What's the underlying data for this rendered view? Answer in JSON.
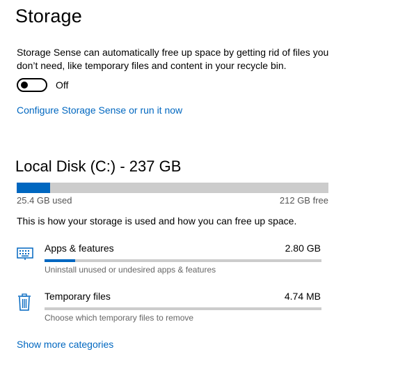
{
  "page_title": "Storage",
  "description": "Storage Sense can automatically free up space by getting rid of files you don’t need, like temporary files and content in your recycle bin.",
  "storage_sense": {
    "state_label": "Off",
    "on": false
  },
  "configure_link": "Configure Storage Sense or run it now",
  "disk": {
    "title": "Local Disk (C:) - 237 GB",
    "used_label": "25.4 GB used",
    "free_label": "212 GB free",
    "used_fraction": 0.107
  },
  "storage_usage_text": "This is how your storage is used and how you can free up space.",
  "categories": [
    {
      "name": "Apps & features",
      "size": "2.80 GB",
      "description": "Uninstall unused or undesired apps & features",
      "fill_fraction": 0.11,
      "icon": "keyboard-icon"
    },
    {
      "name": "Temporary files",
      "size": "4.74 MB",
      "description": "Choose which temporary files to remove",
      "fill_fraction": 0.0,
      "icon": "trash-icon"
    }
  ],
  "show_more_link": "Show more categories",
  "colors": {
    "accent": "#0067c0",
    "track": "#cccccc"
  }
}
